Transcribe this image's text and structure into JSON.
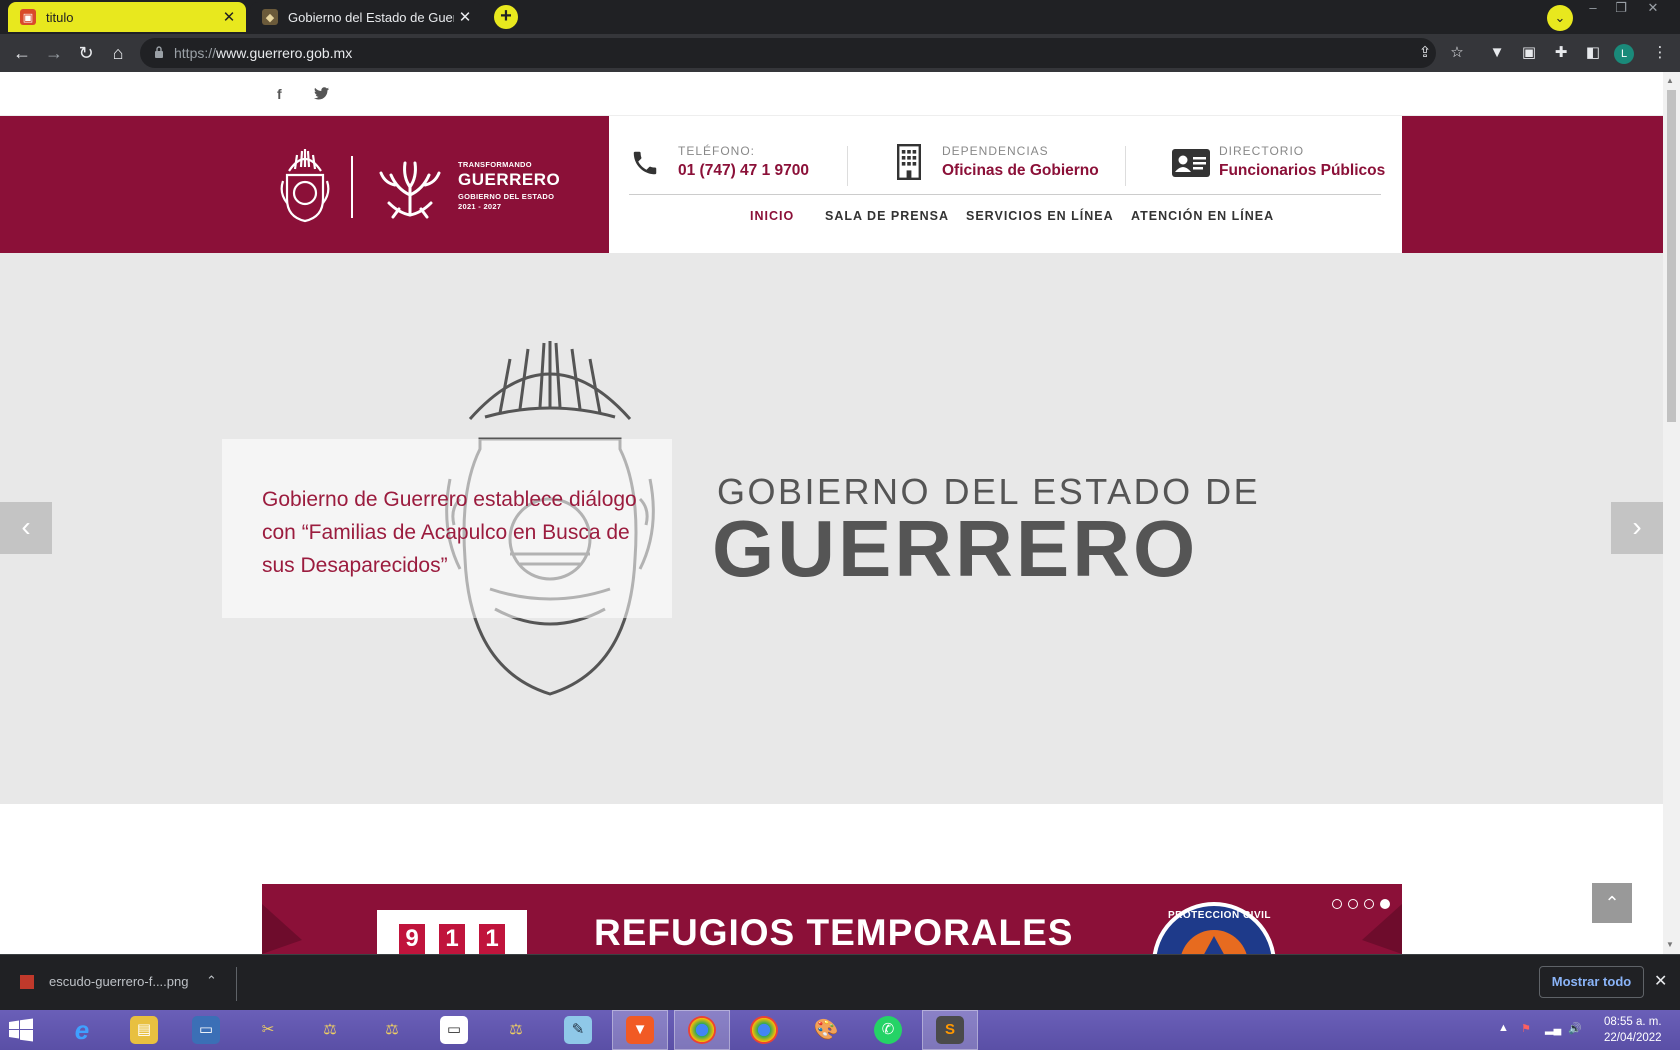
{
  "browser": {
    "tabs": [
      {
        "title": "titulo",
        "active": true
      },
      {
        "title": "Gobierno del Estado de Guerrero",
        "active": false
      }
    ],
    "url_scheme": "https://",
    "url_host": "www.guerrero.gob.mx"
  },
  "site": {
    "logo": {
      "line1": "TRANSFORMANDO",
      "line2": "GUERRERO",
      "line3": "GOBIERNO DEL ESTADO",
      "line4": "2021 - 2027"
    },
    "contacts": [
      {
        "label": "TELÉFONO:",
        "value": "01 (747) 47 1 9700",
        "icon": "phone-icon"
      },
      {
        "label": "DEPENDENCIAS",
        "value": "Oficinas de Gobierno",
        "icon": "building-icon"
      },
      {
        "label": "DIRECTORIO",
        "value": "Funcionarios Públicos",
        "icon": "id-card-icon"
      }
    ],
    "menu": [
      "INICIO",
      "SALA DE PRENSA",
      "SERVICIOS EN LÍNEA",
      "ATENCIÓN EN LÍNEA"
    ],
    "hero": {
      "line1": "GOBIERNO DEL ESTADO DE",
      "line2": "GUERRERO",
      "caption": "Gobierno de Guerrero establece diálogo con “Familias de Acapulco en Busca de sus Desaparecidos”"
    },
    "banner": {
      "digits": [
        "9",
        "1",
        "1"
      ],
      "title": "REFUGIOS TEMPORALES",
      "badge": "PROTECCION CIVIL",
      "slides_total": 4,
      "slide_active": 4
    }
  },
  "downloads": {
    "file": "escudo-guerrero-f....png",
    "show_all": "Mostrar todo"
  },
  "taskbar": {
    "time": "08:55 a. m.",
    "date": "22/04/2022"
  },
  "colors": {
    "brand": "#8b1038",
    "tab_active": "#e8e81e"
  }
}
